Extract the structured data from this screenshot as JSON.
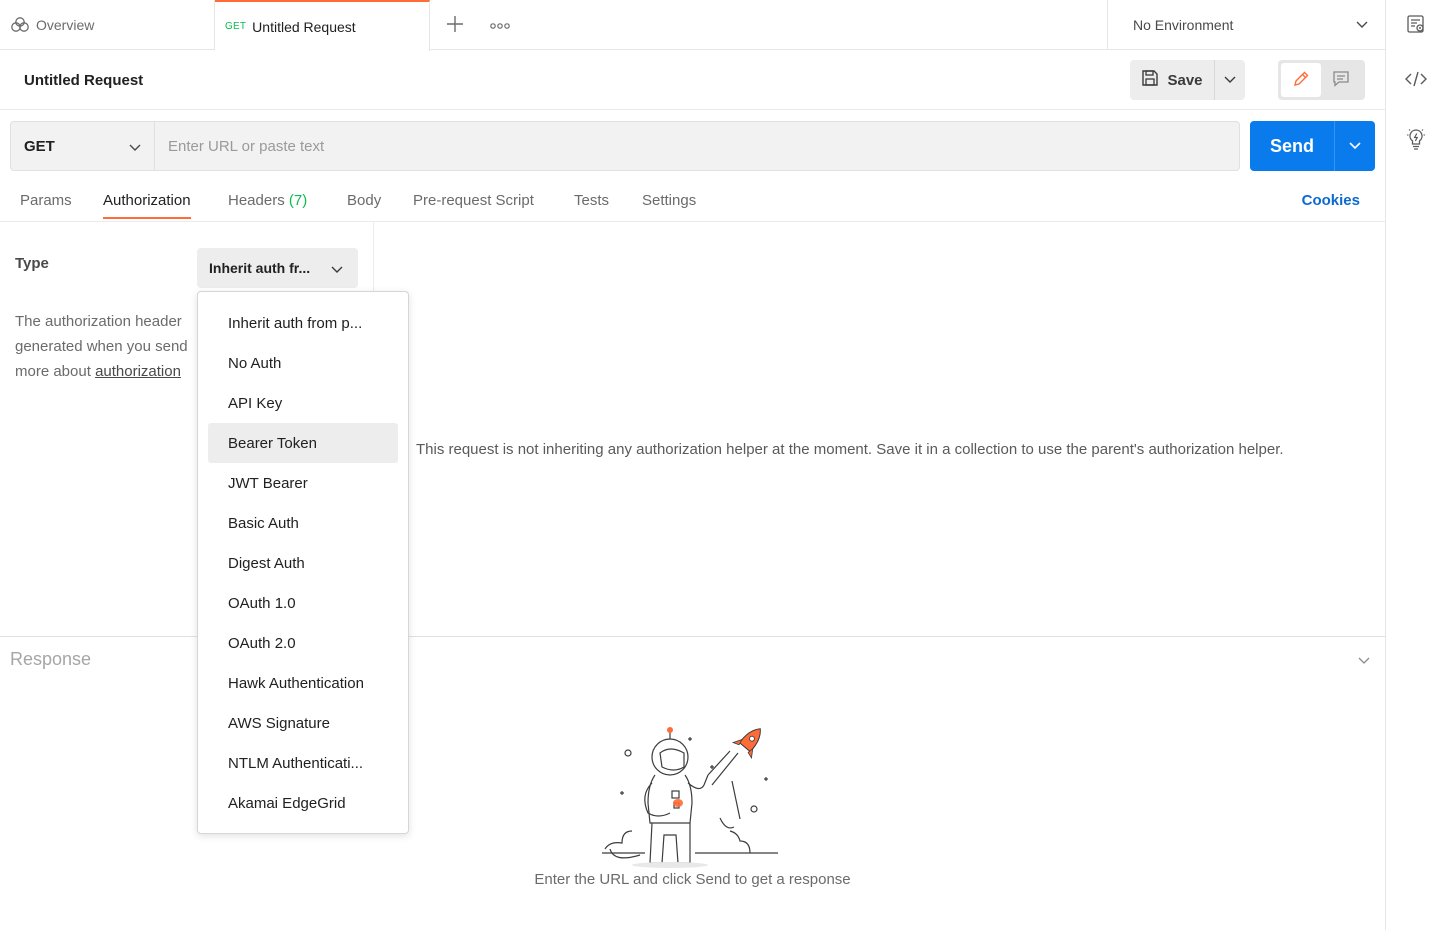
{
  "tabs": {
    "overview_label": "Overview",
    "request_method": "GET",
    "request_label": "Untitled Request"
  },
  "environment": {
    "selected": "No Environment"
  },
  "request": {
    "title": "Untitled Request",
    "save_label": "Save",
    "method": "GET",
    "url_value": "",
    "url_placeholder": "Enter URL or paste text",
    "send_label": "Send"
  },
  "request_tabs": {
    "params": "Params",
    "authorization": "Authorization",
    "headers": "Headers",
    "headers_count": "(7)",
    "body": "Body",
    "prerequest": "Pre-request Script",
    "tests": "Tests",
    "settings": "Settings",
    "cookies": "Cookies",
    "active": "Authorization"
  },
  "auth": {
    "type_label": "Type",
    "selected_type": "Inherit auth fr...",
    "description_line1": "The authorization header",
    "description_line2": "generated when you send",
    "description_line3_prefix": "more about",
    "description_link": "authorization",
    "message": "This request is not inheriting any authorization helper at the moment. Save it in a collection to use the parent's authorization helper."
  },
  "auth_menu": {
    "items": [
      "Inherit auth from p...",
      "No Auth",
      "API Key",
      "Bearer Token",
      "JWT Bearer",
      "Basic Auth",
      "Digest Auth",
      "OAuth 1.0",
      "OAuth 2.0",
      "Hawk Authentication",
      "AWS Signature",
      "NTLM Authenticati...",
      "Akamai EdgeGrid"
    ],
    "hovered": "Bearer Token"
  },
  "response": {
    "title": "Response",
    "empty_message": "Enter the URL and click Send to get a response"
  },
  "colors": {
    "accent": "#ff6c37",
    "send_blue": "#097bed",
    "method_green": "#0cbb52",
    "link_blue": "#0b6acf"
  },
  "icons": {
    "overview": "workspace-icon",
    "new_tab": "plus-icon",
    "more": "ellipsis-icon",
    "save": "floppy-disk-icon",
    "edit": "pencil-icon",
    "comment": "comment-icon",
    "code": "code-icon",
    "tips": "lightbulb-icon",
    "env_quicklook": "env-quicklook-icon"
  }
}
